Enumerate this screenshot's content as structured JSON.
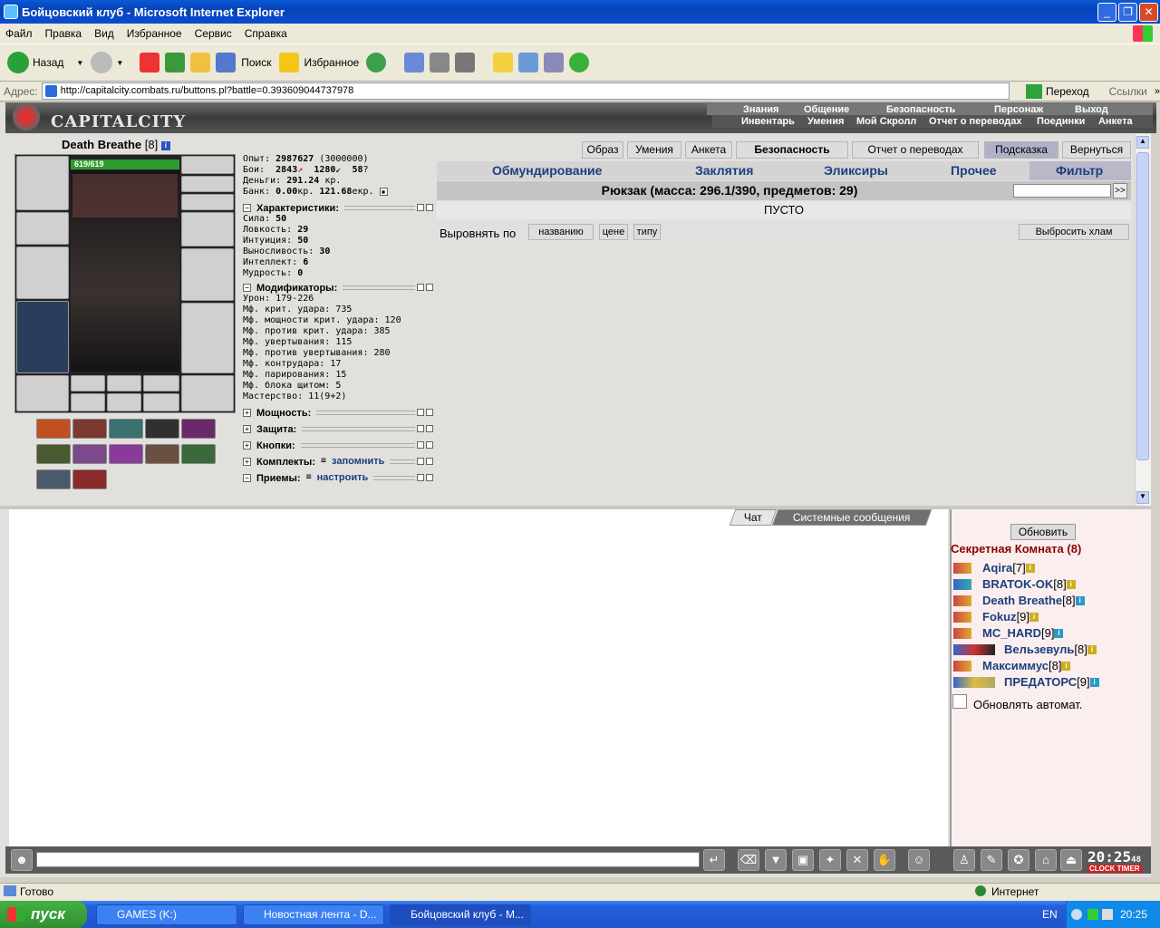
{
  "window": {
    "title": "Бойцовский клуб - Microsoft Internet Explorer"
  },
  "menu": [
    "Файл",
    "Правка",
    "Вид",
    "Избранное",
    "Сервис",
    "Справка"
  ],
  "toolbar": {
    "back": "Назад",
    "search": "Поиск",
    "favorites": "Избранное"
  },
  "address": {
    "label": "Адрес:",
    "url": "http://capitalcity.combats.ru/buttons.pl?battle=0.393609044737978",
    "go": "Переход",
    "links": "Ссылки"
  },
  "game": {
    "logo": "CAPITALCITY",
    "nav_top": [
      "Знания",
      "Общение",
      "Безопасность",
      "Персонаж",
      "Выход"
    ],
    "nav_bottom": [
      "Инвентарь",
      "Умения",
      "Мой Скролл",
      "Отчет о переводах",
      "Поединки",
      "Анкета"
    ]
  },
  "character": {
    "name": "Death Breathe",
    "level": "[8]",
    "hp": "619/619",
    "exp_label": "Опыт:",
    "exp": "2987627",
    "exp_next": "(3000000)",
    "fights_label": "Бои:",
    "wins": "2843",
    "losses": "1280",
    "draws": "58",
    "money_label": "Деньги:",
    "money": "291.24",
    "money_unit": "кр.",
    "bank_label": "Банк:",
    "bank": "0.00",
    "bank_unit": "кр.",
    "bank_ekr": "121.68",
    "bank_ekr_unit": "екр."
  },
  "sections": {
    "characteristics": "Характеристики:",
    "modifiers": "Модификаторы:",
    "power": "Мощность:",
    "defense": "Защита:",
    "buttons": "Кнопки:",
    "sets": "Комплекты:",
    "sets_link": "запомнить",
    "techniques": "Приемы:",
    "techniques_link": "настроить"
  },
  "stats": [
    {
      "label": "Сила:",
      "value": "50"
    },
    {
      "label": "Ловкость:",
      "value": "29"
    },
    {
      "label": "Интуиция:",
      "value": "50"
    },
    {
      "label": "Выносливость:",
      "value": "30"
    },
    {
      "label": "Интеллект:",
      "value": "6"
    },
    {
      "label": "Мудрость:",
      "value": "0"
    }
  ],
  "modifiers": [
    "Урон: 179-226",
    "Мф. крит. удара: 735",
    "Мф. мощности крит. удара: 120",
    "Мф. против крит. удара: 385",
    "Мф. увертывания: 115",
    "Мф. против увертывания: 280",
    "Мф. контрудара: 17",
    "Мф. парирования: 15",
    "Мф. блока щитом: 5",
    "Мастерство: 11(9+2)"
  ],
  "top_buttons": [
    "Образ",
    "Умения",
    "Анкета",
    "Безопасность",
    "Отчет о переводах",
    "Подсказка",
    "Вернуться"
  ],
  "inventory": {
    "tabs": [
      "Обмундирование",
      "Заклятия",
      "Эликсиры",
      "Прочее",
      "Фильтр"
    ],
    "backpack": "Рюкзак (масса: 296.1/390, предметов: 29)",
    "empty": "ПУСТО",
    "sort_label": "Выровнять по",
    "sort_name": "названию",
    "sort_price": "цене",
    "sort_type": "типу",
    "discard": "Выбросить хлам",
    "search_btn": ">>"
  },
  "chat": {
    "tab_chat": "Чат",
    "tab_system": "Системные сообщения"
  },
  "room": {
    "refresh": "Обновить",
    "title": "Секретная Комната (8)",
    "auto": "Обновлять автомат.",
    "users": [
      {
        "name": "Aqira",
        "level": "[7]"
      },
      {
        "name": "BRATOK-OK",
        "level": "[8]"
      },
      {
        "name": "Death Breathe",
        "level": "[8]"
      },
      {
        "name": "Fokuz",
        "level": "[9]"
      },
      {
        "name": "MC_HARD",
        "level": "[9]"
      },
      {
        "name": "Вельзевуль",
        "level": "[8]"
      },
      {
        "name": "Максиммус",
        "level": "[8]"
      },
      {
        "name": "ПРЕДАТОРС",
        "level": "[9]"
      }
    ]
  },
  "clock": {
    "time": "20:25",
    "sec": "48",
    "label": "CLOCK TIMER"
  },
  "statusbar": {
    "status": "Готово",
    "zone": "Интернет"
  },
  "taskbar": {
    "start": "пуск",
    "tasks": [
      "GAMES (K:)",
      "Новостная лента - D...",
      "Бойцовский клуб - M..."
    ],
    "lang": "EN",
    "time": "20:25"
  }
}
